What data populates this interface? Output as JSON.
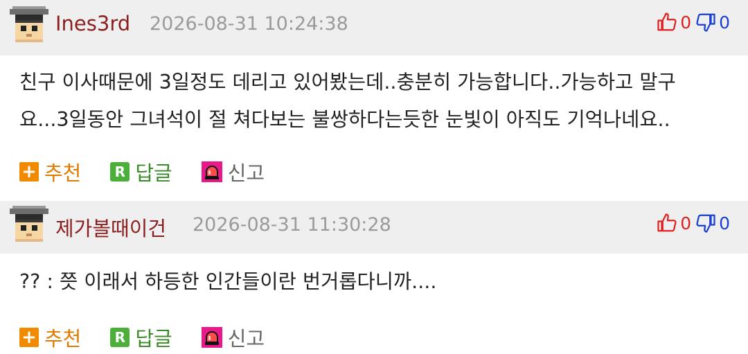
{
  "comments": [
    {
      "username": "Ines3rd",
      "timestamp": "2026-08-31 10:24:38",
      "upvotes": "0",
      "downvotes": "0",
      "body_lines": [
        "친구 이사때문에 3일정도 데리고 있어봤는데..충분히 가능합니다..가능하고 말구",
        "요...3일동안 그녀석이 절 쳐다보는 불쌍하다는듯한 눈빛이 아직도 기억나네요.."
      ],
      "actions": {
        "recommend": "추천",
        "reply": "답글",
        "report": "신고"
      }
    },
    {
      "username": "제가볼때이건",
      "timestamp": "2026-08-31 11:30:28",
      "upvotes": "0",
      "downvotes": "0",
      "body_lines": [
        "?? : 쯧 이래서 하등한 인간들이란 번거롭다니까...."
      ],
      "actions": {
        "recommend": "추천",
        "reply": "답글",
        "report": "신고"
      }
    }
  ],
  "icons": {
    "avatar": "pixel-character-graduation-cap",
    "upvote": "thumbs-up-outline-icon",
    "downvote": "thumbs-down-outline-icon",
    "recommend": "plus-square-icon",
    "reply": "r-square-icon",
    "report": "siren-icon"
  },
  "colors": {
    "username": "#8b1f1f",
    "timestamp": "#9a9a9a",
    "upvote": "#e02020",
    "downvote": "#1a3fd1",
    "recommend": "#e07b00",
    "reply": "#3a8a2a",
    "header_bg": "#efefef"
  }
}
